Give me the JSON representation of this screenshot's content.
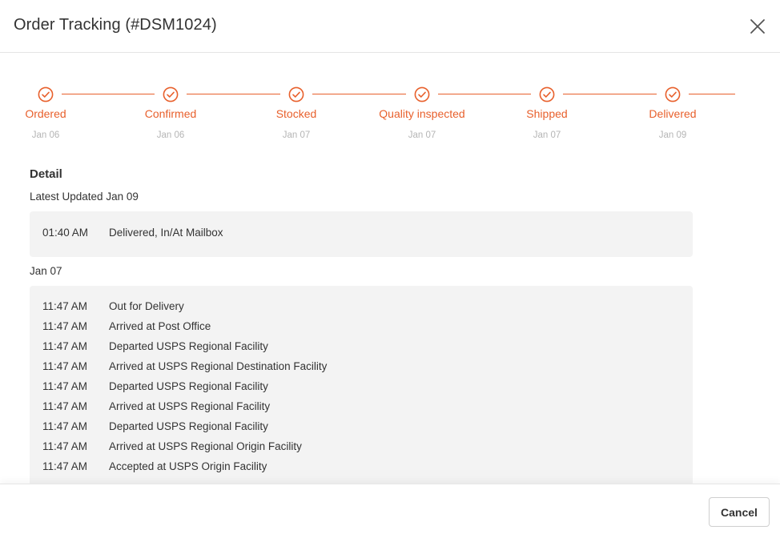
{
  "modal": {
    "title": "Order Tracking (#DSM1024)",
    "close_icon": "close-icon",
    "accent_color": "#e8602c"
  },
  "steps": [
    {
      "label": "Ordered",
      "date": "Jan 06",
      "status": "completed",
      "icon": "check-circle-icon"
    },
    {
      "label": "Confirmed",
      "date": "Jan 06",
      "status": "completed",
      "icon": "check-circle-icon"
    },
    {
      "label": "Stocked",
      "date": "Jan 07",
      "status": "completed",
      "icon": "check-circle-icon"
    },
    {
      "label": "Quality inspected",
      "date": "Jan 07",
      "status": "completed",
      "icon": "check-circle-icon"
    },
    {
      "label": "Shipped",
      "date": "Jan 07",
      "status": "completed",
      "icon": "check-circle-icon"
    },
    {
      "label": "Delivered",
      "date": "Jan 09",
      "status": "completed",
      "icon": "check-circle-icon"
    }
  ],
  "detail": {
    "title": "Detail",
    "groups": [
      {
        "label": "Latest Updated Jan 09",
        "events": [
          {
            "time": "01:40 AM",
            "description": "Delivered, In/At Mailbox"
          }
        ]
      },
      {
        "label": "Jan 07",
        "events": [
          {
            "time": "11:47 AM",
            "description": "Out for Delivery"
          },
          {
            "time": "11:47 AM",
            "description": "Arrived at Post Office"
          },
          {
            "time": "11:47 AM",
            "description": "Departed USPS Regional Facility"
          },
          {
            "time": "11:47 AM",
            "description": "Arrived at USPS Regional Destination Facility"
          },
          {
            "time": "11:47 AM",
            "description": "Departed USPS Regional Facility"
          },
          {
            "time": "11:47 AM",
            "description": "Arrived at USPS Regional Facility"
          },
          {
            "time": "11:47 AM",
            "description": "Departed USPS Regional Facility"
          },
          {
            "time": "11:47 AM",
            "description": "Arrived at USPS Regional Origin Facility"
          },
          {
            "time": "11:47 AM",
            "description": "Accepted at USPS Origin Facility"
          }
        ]
      }
    ]
  },
  "footer": {
    "cancel_label": "Cancel"
  }
}
